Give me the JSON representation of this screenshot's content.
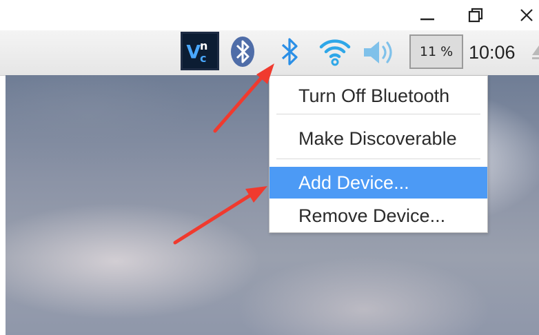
{
  "window_controls": {
    "minimize_icon": "minimize-icon",
    "maximize_icon": "restore-icon",
    "close_icon": "close-icon"
  },
  "panel": {
    "tray_icons": [
      "vnc-icon",
      "bluetooth-circle-icon",
      "bluetooth-icon",
      "wifi-icon",
      "volume-icon"
    ],
    "cpu_usage": "11 %",
    "clock": "10:06"
  },
  "bluetooth_menu": {
    "items": [
      {
        "label": "Turn Off Bluetooth"
      },
      {
        "label": "Make Discoverable"
      },
      {
        "label": "Add Device..."
      },
      {
        "label": "Remove Device..."
      }
    ],
    "highlighted_item": "Add Device..."
  },
  "colors": {
    "accent": "#4c9af5",
    "bluetooth_blue": "#2b8fe6",
    "arrow_red": "#f03a2e"
  }
}
